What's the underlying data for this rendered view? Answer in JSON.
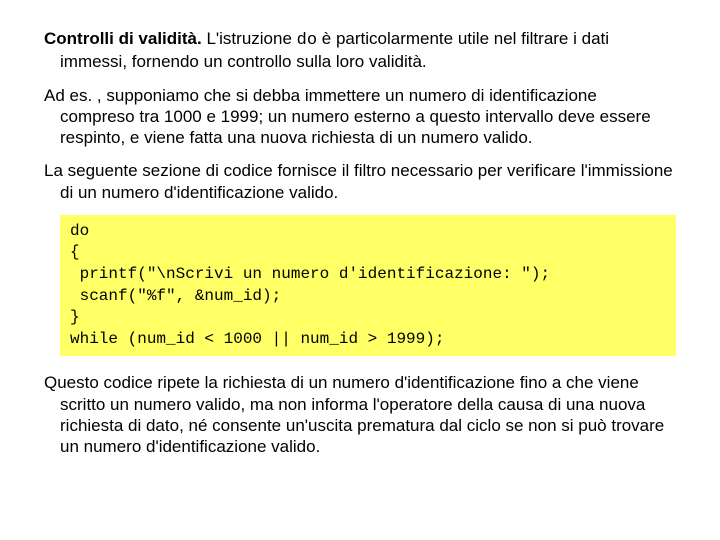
{
  "para1_a": "Controlli di validità.",
  "para1_b": " L'istruzione ",
  "para1_code": "do",
  "para1_c": " è particolarmente utile nel filtrare i dati immessi, fornendo un controllo sulla loro validità.",
  "para2": "Ad es. , supponiamo che si debba immettere un numero di identificazione compreso tra 1000 e 1999; un numero esterno a questo intervallo deve essere respinto, e viene fatta una nuova richiesta di un numero valido.",
  "para3": "La seguente sezione di codice fornisce il filtro necessario per verificare l'immissione di un numero d'identificazione valido.",
  "code": "do\n{\n printf(\"\\nScrivi un numero d'identificazione: \");\n scanf(\"%f\", &num_id);\n}\nwhile (num_id < 1000 || num_id > 1999);",
  "para4": "Questo codice ripete la richiesta di un numero d'identificazione fino a che viene scritto un numero valido, ma non informa l'operatore della causa di una nuova richiesta di dato, né consente un'uscita prematura dal ciclo se non si può trovare un numero d'identificazione valido."
}
